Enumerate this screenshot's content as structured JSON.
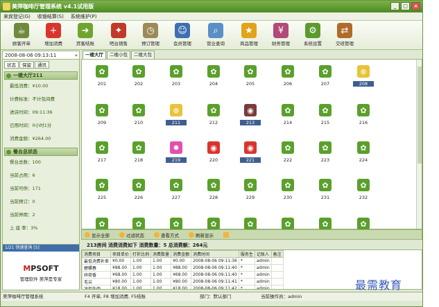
{
  "window": {
    "title": "美萍咖啡厅管理系统 v4.1试用版"
  },
  "menu": [
    "来宾登记(G)",
    "收银结算(S)",
    "系统维护(P)"
  ],
  "toolbar": [
    {
      "label": "顾客开单",
      "icon": "open-order-icon",
      "color": "#6f8a3a"
    },
    {
      "label": "增加消费",
      "icon": "add-consumption-icon",
      "color": "#d9352c"
    },
    {
      "label": "宾客结账",
      "icon": "checkout-icon",
      "color": "#6fa52e"
    },
    {
      "label": "吧台销售",
      "icon": "bar-sales-icon",
      "color": "#c0392b"
    },
    {
      "label": "预订管理",
      "icon": "booking-clock-icon",
      "color": "#9c8a5a"
    },
    {
      "label": "会员管理",
      "icon": "members-icon",
      "color": "#3e6fb0"
    },
    {
      "label": "营业查询",
      "icon": "query-icon",
      "color": "#5a8fc8"
    },
    {
      "label": "商品管理",
      "icon": "star-icon",
      "color": "#e1a319"
    },
    {
      "label": "财务管理",
      "icon": "finance-icon",
      "color": "#b04a7a"
    },
    {
      "label": "系统设置",
      "icon": "settings-icon",
      "color": "#5c9a2e"
    },
    {
      "label": "交班管理",
      "icon": "shift-icon",
      "color": "#b06a2a"
    }
  ],
  "clock": "2008-08-06 09:13:11",
  "left_tabs": [
    "状态",
    "保留",
    "通讯"
  ],
  "room_section": {
    "title": "一楼大厅211",
    "rows": [
      "最低消费：¥10.00",
      "计费标准：不计包间费",
      "进店时间：09:11:36",
      "已用时间：0小时1分",
      "消费金额：¥264.00"
    ]
  },
  "status_section": {
    "title": "餐台总状态",
    "rows": [
      "餐台总数：100",
      "当前占用：6",
      "当前可供：171",
      "当前预订：0",
      "当前停用：2",
      "上 座 率：3%"
    ]
  },
  "ad": {
    "header": "1/21 快速查询 [S]",
    "logo_red": "M",
    "logo_rest": "PSOFT",
    "slogan": "管理软件 美萍是专家"
  },
  "main_tabs": [
    "一楼大厅",
    "二楼小包",
    "二楼大包"
  ],
  "tables": [
    {
      "num": "201",
      "status": "free"
    },
    {
      "num": "202",
      "status": "free"
    },
    {
      "num": "203",
      "status": "free"
    },
    {
      "num": "204",
      "status": "free"
    },
    {
      "num": "205",
      "status": "free"
    },
    {
      "num": "206",
      "status": "free"
    },
    {
      "num": "207",
      "status": "free"
    },
    {
      "num": "208",
      "status": "disabled"
    },
    {
      "num": "209",
      "status": "free"
    },
    {
      "num": "210",
      "status": "free"
    },
    {
      "num": "211",
      "status": "disabled"
    },
    {
      "num": "212",
      "status": "free"
    },
    {
      "num": "213",
      "status": "occupied-dark"
    },
    {
      "num": "214",
      "status": "free"
    },
    {
      "num": "215",
      "status": "free"
    },
    {
      "num": "216",
      "status": "free"
    },
    {
      "num": "217",
      "status": "free"
    },
    {
      "num": "218",
      "status": "free"
    },
    {
      "num": "219",
      "status": "reserved"
    },
    {
      "num": "220",
      "status": "occupied"
    },
    {
      "num": "221",
      "status": "occupied"
    },
    {
      "num": "222",
      "status": "free"
    },
    {
      "num": "223",
      "status": "free"
    },
    {
      "num": "224",
      "status": "free"
    },
    {
      "num": "225",
      "status": "free"
    },
    {
      "num": "226",
      "status": "free"
    },
    {
      "num": "227",
      "status": "free"
    },
    {
      "num": "228",
      "status": "free"
    },
    {
      "num": "229",
      "status": "free"
    },
    {
      "num": "230",
      "status": "free"
    },
    {
      "num": "231",
      "status": "free"
    },
    {
      "num": "232",
      "status": "free"
    },
    {
      "num": "",
      "status": "free"
    },
    {
      "num": "",
      "status": "free"
    },
    {
      "num": "",
      "status": "free"
    },
    {
      "num": "",
      "status": "free"
    },
    {
      "num": "",
      "status": "free"
    },
    {
      "num": "",
      "status": "free"
    },
    {
      "num": "",
      "status": "free"
    },
    {
      "num": "",
      "status": "free"
    }
  ],
  "selected_tables": [
    "208",
    "211",
    "213",
    "219",
    "221"
  ],
  "colors": {
    "free": "#5aa02c",
    "disabled": "#e8c33a",
    "occupied": "#d9352c",
    "occupied-dark": "#7a3b3b",
    "reserved": "#e14fb0"
  },
  "actions": [
    "显示全部",
    "过滤状态",
    "查看方式",
    "刷新显示",
    ""
  ],
  "summary": "213房间   消费消费如下   消费数量：5   总消费额：264元",
  "table_headers": [
    "消费项目",
    "项目单价",
    "打折比例",
    "消费数量",
    "消费金额",
    "消费时间",
    "服务生",
    "记账人",
    "备注"
  ],
  "table_rows": [
    [
      "最低消费补差",
      "¥0.00",
      "1.00",
      "1.00",
      "¥0.00",
      "2008-08-06 09:11:36",
      "*",
      "admin",
      ""
    ],
    [
      "碧螺春",
      "¥88.00",
      "1.00",
      "1.00",
      "¥88.00",
      "2008-08-06 09:11:40",
      "*",
      "admin",
      ""
    ],
    [
      "碎荷香",
      "¥68.00",
      "1.00",
      "1.00",
      "¥68.00",
      "2008-08-06 09:11:40",
      "*",
      "admin",
      ""
    ],
    [
      "毛尖",
      "¥80.00",
      "1.00",
      "1.00",
      "¥80.00",
      "2008-08-06 09:11:41",
      "*",
      "admin",
      ""
    ],
    [
      "凉拌牛肉",
      "¥18.00",
      "1.00",
      "1.00",
      "¥18.00",
      "2008-08-06 09:11:42",
      "*",
      "admin",
      ""
    ]
  ],
  "status": [
    "美萍咖啡厅管理系统",
    "F4 开单, F8 增加消费, F5结账",
    "部门：默认部门",
    "当前操作员：admin"
  ],
  "watermark": "最需教育"
}
